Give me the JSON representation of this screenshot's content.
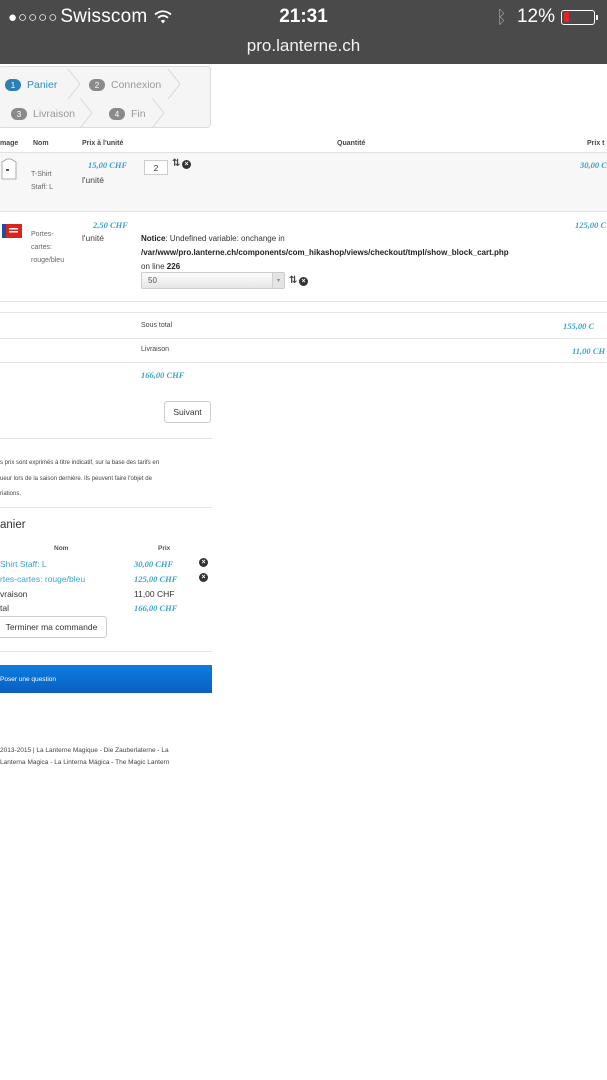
{
  "statusbar": {
    "signal_dots": "●○○○○",
    "carrier": "Swisscom",
    "time": "21:31",
    "battery": "12%",
    "battery_level": 0.12
  },
  "url": "pro.lanterne.ch",
  "steps": [
    {
      "num": "1",
      "label": "Panier",
      "active": true
    },
    {
      "num": "2",
      "label": "Connexion",
      "active": false
    },
    {
      "num": "3",
      "label": "Livraison",
      "active": false
    },
    {
      "num": "4",
      "label": "Fin",
      "active": false
    }
  ],
  "cart": {
    "headers": {
      "image": "mage",
      "name": "Nom",
      "unit_price": "Prix à l'unité",
      "quantity": "Quantité",
      "total": "Prix t"
    },
    "items": [
      {
        "name_line1": "T-Shirt",
        "name_line2": "Staff: L",
        "unit_price": "15,00 CHF",
        "unit_label": "l'unité",
        "quantity": "2",
        "total": "30,00 C"
      },
      {
        "name_line1": "Portes-",
        "name_line2": "cartes:",
        "name_line3": "rouge/bleu",
        "unit_price": "2,50 CHF",
        "unit_label": "l'unité",
        "notice_label": "Notice",
        "notice_text": ": Undefined variable: onchange in",
        "notice_path": "/var/www/pro.lanterne.ch/components/com_hikashop/views/checkout/tmpl/show_block_cart.php",
        "notice_line_prefix": "on line ",
        "notice_line": "226",
        "select_value": "50",
        "total": "125,00 C"
      }
    ],
    "subtotal_label": "Sous total",
    "subtotal_value": "155,00 C",
    "shipping_label": "Livraison",
    "shipping_value": "11,00 CH",
    "grand_total": "166,00 CHF"
  },
  "next_button": "Suivant",
  "disclaimer": [
    "s prix sont exprimés à titre indicatif, sur la base des tarifs en",
    "ueur lors de la saison dernière. Ils peuvent faire l'objet de",
    "riations."
  ],
  "mini_cart": {
    "title": "anier",
    "header_name": "Nom",
    "header_price": "Prix",
    "items": [
      {
        "name": "Shirt Staff: L",
        "price": "30,00 CHF"
      },
      {
        "name": "rtes-cartes: rouge/bleu",
        "price": "125,00 CHF"
      }
    ],
    "shipping_label": "vraison",
    "shipping_value": "11,00 CHF",
    "total_label": "tal",
    "total_value": "166,00 CHF",
    "finish_button": "Terminer ma commande"
  },
  "question_button": "Poser une question",
  "footer": [
    "2013-2015 | La Lanterne Magique - Die Zauberlaterne - La",
    "Lanterna Magica - La Linterna Mágica - The Magic Lantern"
  ],
  "colors": {
    "accent": "#3aa3c9",
    "step_active": "#2d7fb8",
    "question_bg": "#0a6fd4",
    "battery_low": "#e02424"
  }
}
